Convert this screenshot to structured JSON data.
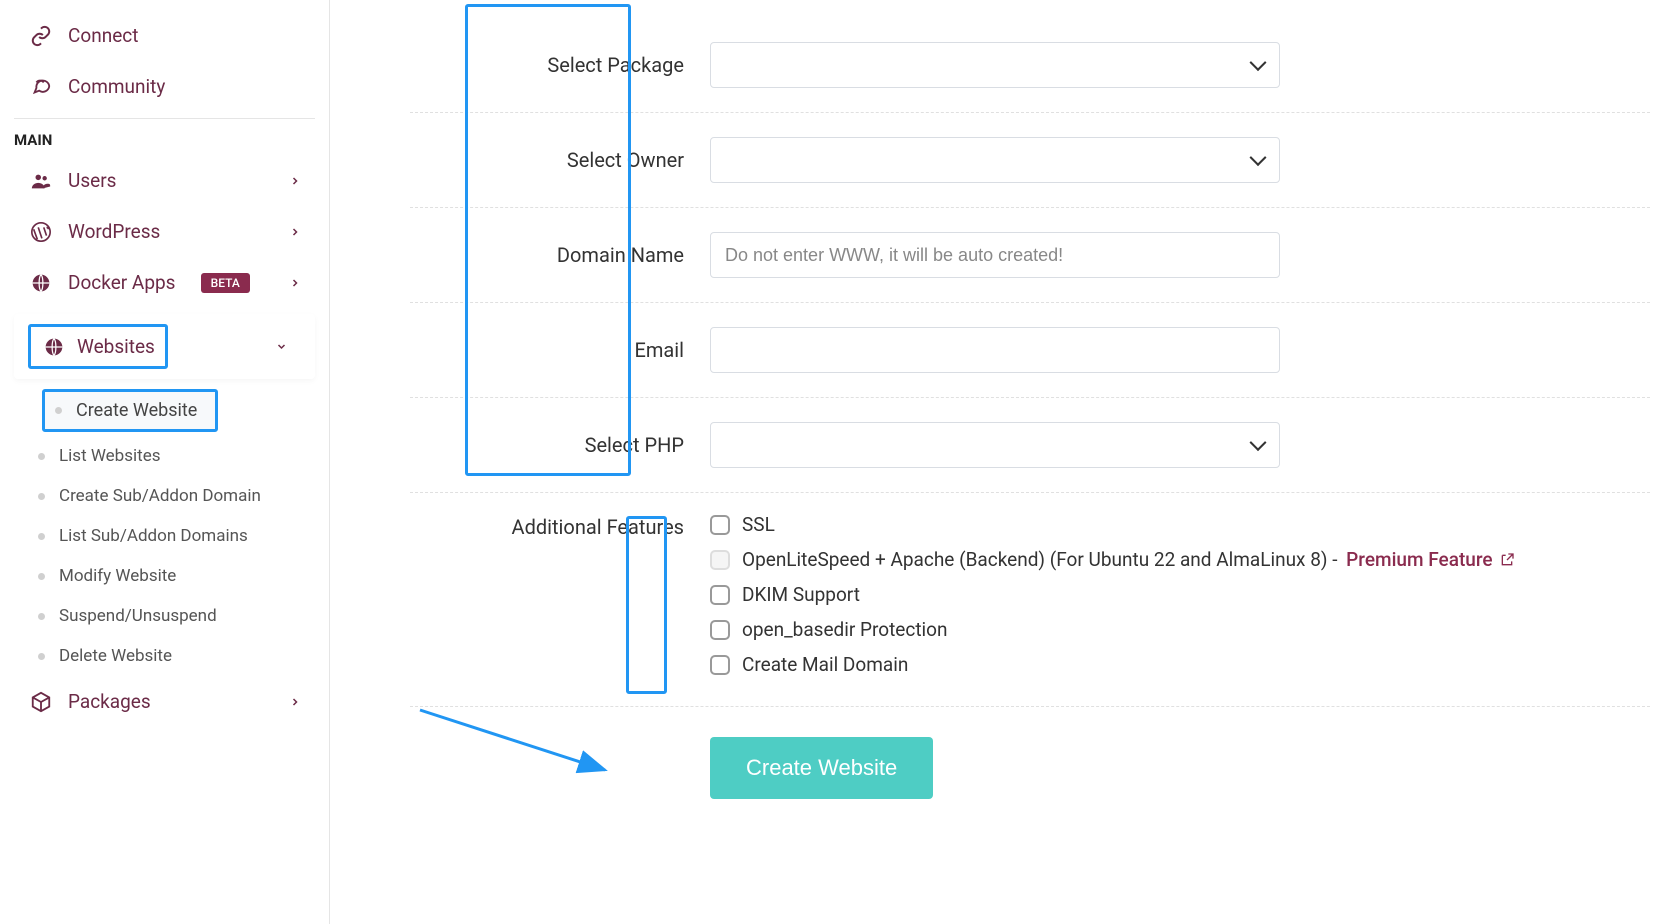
{
  "sidebar": {
    "top": [
      {
        "icon": "link",
        "label": "Connect"
      },
      {
        "icon": "chat",
        "label": "Community"
      }
    ],
    "section_label": "MAIN",
    "main_items": [
      {
        "icon": "users",
        "label": "Users",
        "expandable": true
      },
      {
        "icon": "wordpress",
        "label": "WordPress",
        "expandable": true
      },
      {
        "icon": "docker",
        "label": "Docker Apps",
        "badge": "BETA",
        "expandable": true
      }
    ],
    "websites_label": "Websites",
    "websites_submenu": [
      "Create Website",
      "List Websites",
      "Create Sub/Addon Domain",
      "List Sub/Addon Domains",
      "Modify Website",
      "Suspend/Unsuspend",
      "Delete Website"
    ],
    "packages_label": "Packages"
  },
  "form": {
    "labels": {
      "select_package": "Select Package",
      "select_owner": "Select Owner",
      "domain_name": "Domain Name",
      "email": "Email",
      "select_php": "Select PHP",
      "additional_features": "Additional Features"
    },
    "domain_placeholder": "Do not enter WWW, it will be auto created!",
    "features": {
      "ssl": "SSL",
      "ols_apache": "OpenLiteSpeed + Apache (Backend) (For Ubuntu 22 and AlmaLinux 8) - ",
      "premium_text": "Premium Feature",
      "dkim": "DKIM Support",
      "open_basedir": "open_basedir Protection",
      "mail_domain": "Create Mail Domain"
    },
    "submit_label": "Create Website"
  }
}
